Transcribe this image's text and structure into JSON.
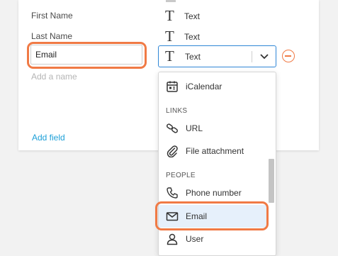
{
  "fields": [
    {
      "name": "First Name",
      "type_label": "Text"
    },
    {
      "name": "Last Name",
      "type_label": "Text"
    }
  ],
  "editing_field": {
    "name_value": "Email",
    "type_label": "Text",
    "icon": "text-icon"
  },
  "add_name_placeholder": "Add a name",
  "add_field_label": "Add field",
  "dropdown": {
    "items": [
      {
        "label": "iCalendar",
        "icon": "calendar-icon"
      },
      {
        "label": "URL",
        "icon": "link-icon"
      },
      {
        "label": "File attachment",
        "icon": "paperclip-icon"
      },
      {
        "label": "Phone number",
        "icon": "phone-icon"
      },
      {
        "label": "Email",
        "icon": "envelope-icon",
        "selected": true
      },
      {
        "label": "User",
        "icon": "user-icon"
      }
    ],
    "sections": {
      "links": "LINKS",
      "people": "PEOPLE"
    }
  },
  "colors": {
    "highlight": "#f07a45",
    "link": "#1ea0d8",
    "focus_border": "#2f86d6",
    "selected_bg": "#e6f0fb"
  }
}
